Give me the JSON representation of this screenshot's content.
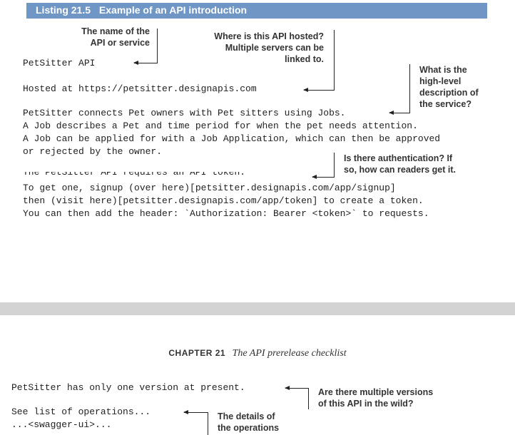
{
  "listing": {
    "label": "Listing 21.5",
    "title": "Example of an API introduction"
  },
  "code_lines": [
    "PetSitter API",
    "Hosted at https://petsitter.designapis.com",
    "PetSitter connects Pet owners with Pet sitters using Jobs.",
    "A Job describes a Pet and time period for when the pet needs attention.",
    "A Job can be applied for with a Job Application, which can then be approved",
    "or rejected by the owner.",
    "The PetSitter API requires an API token.",
    "To get one, signup (over here)[petsitter.designapis.com/app/signup]",
    "then (visit here)[petsitter.designapis.com/app/token] to create a token.",
    "You can then add the header: `Authorization: Bearer <token>` to requests."
  ],
  "annotations": {
    "name": [
      "The name of the",
      "API or service"
    ],
    "hosted": [
      "Where is this API hosted?",
      "Multiple servers can be",
      "linked to."
    ],
    "description": [
      "What is the",
      "high-level",
      "description of",
      "the service?"
    ],
    "auth": [
      "Is there authentication? If",
      "so, how can readers get it."
    ],
    "versions": [
      "Are there multiple versions",
      "of this API in the wild?"
    ],
    "operations": [
      "The details of",
      "the operations"
    ]
  },
  "chapter": {
    "label": "CHAPTER 21",
    "title": "The API prerelease checklist"
  },
  "page2_code": [
    "PetSitter has only one version at present.",
    "See list of operations...",
    "...<swagger-ui>..."
  ],
  "colors": {
    "listing_bar": "#6f96c4",
    "page_gap": "#d3d3d3"
  }
}
